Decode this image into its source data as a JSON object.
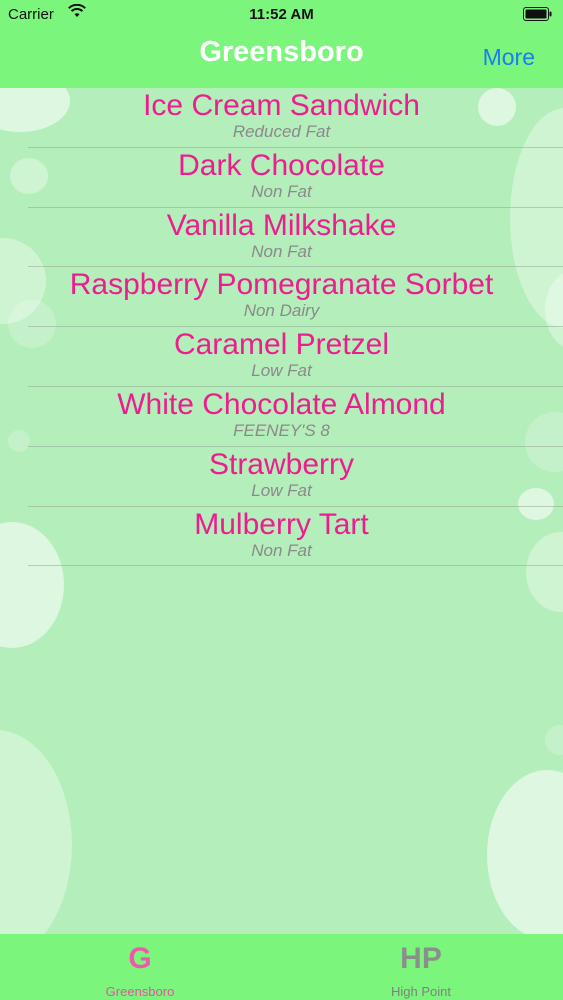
{
  "status_bar": {
    "carrier": "Carrier",
    "time": "11:52 AM"
  },
  "nav": {
    "title": "Greensboro",
    "more_label": "More"
  },
  "flavors": [
    {
      "name": "Ice Cream Sandwich",
      "note": "Reduced Fat"
    },
    {
      "name": "Dark Chocolate",
      "note": "Non Fat"
    },
    {
      "name": "Vanilla Milkshake",
      "note": "Non Fat"
    },
    {
      "name": "Raspberry Pomegranate Sorbet",
      "note": "Non Dairy"
    },
    {
      "name": "Caramel Pretzel",
      "note": "Low Fat"
    },
    {
      "name": "White Chocolate Almond",
      "note": "FEENEY'S 8"
    },
    {
      "name": "Strawberry",
      "note": "Low Fat"
    },
    {
      "name": "Mulberry Tart",
      "note": "Non Fat"
    }
  ],
  "tabs": [
    {
      "glyph": "G",
      "label": "Greensboro",
      "active": true
    },
    {
      "glyph": "HP",
      "label": "High Point",
      "active": false
    }
  ],
  "colors": {
    "bar_green": "#7cf57d",
    "background_green": "#b4eebb",
    "flavor_pink": "#ee1d8f",
    "more_blue": "#1a7ef2"
  },
  "icons": [
    "wifi-icon",
    "battery-icon"
  ]
}
